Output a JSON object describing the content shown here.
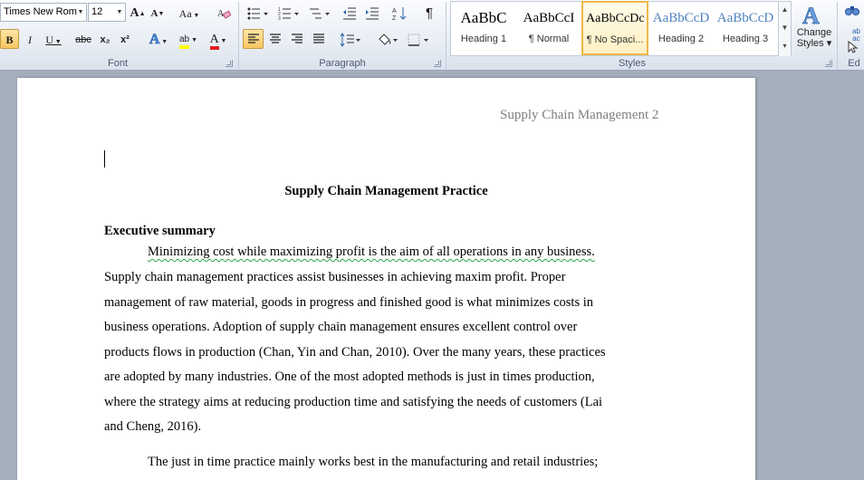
{
  "font_group": {
    "font_name": "Times New Rom",
    "font_size": "12",
    "label": "Font",
    "grow_label": "A",
    "shrink_label": "A",
    "case_label": "Aa",
    "bold_label": "B",
    "italic_label": "I",
    "underline_label": "U",
    "strike_label": "abc",
    "subscript_label": "x₂",
    "superscript_label": "x²",
    "effects_label": "A",
    "highlight_label": "ab",
    "color_label": "A"
  },
  "paragraph_group": {
    "label": "Paragraph",
    "pilcrow": "¶"
  },
  "styles_group": {
    "label": "Styles",
    "tiles": [
      {
        "sample": "AaBbC",
        "name": "Heading 1",
        "color": "#000000"
      },
      {
        "sample": "AaBbCcI",
        "name": "¶ Normal",
        "color": "#000000"
      },
      {
        "sample": "AaBbCcDc",
        "name": "¶ No Spaci...",
        "color": "#000000"
      },
      {
        "sample": "AaBbCcD",
        "name": "Heading 2",
        "color": "#4f81bd"
      },
      {
        "sample": "AaBbCcD",
        "name": "Heading 3",
        "color": "#4f81bd"
      }
    ],
    "change_styles_line1": "Change",
    "change_styles_line2": "Styles ▾"
  },
  "editing_group": {
    "label": "Ed",
    "replace_label": "ab\nac"
  },
  "document": {
    "header": "Supply Chain Management 2",
    "title": "Supply Chain Management Practice",
    "heading": "Executive summary",
    "para1_first": "Minimizing  cost while maximizing  profit is the aim of all operations in any business.",
    "para1_lines": [
      "Supply chain management practices assist businesses in achieving maxim profit. Proper",
      "management of raw material,  goods in progress and finished good is what minimizes  costs in",
      "business operations. Adoption of supply chain management ensures excellent control over",
      "products flows in production (Chan, Yin and Chan, 2010). Over the many years, these practices",
      "are adopted by many industries. One of the most adopted methods is just in times production,",
      "where the strategy aims  at reducing production time and satisfying the needs of customers (Lai",
      "and Cheng, 2016)."
    ],
    "para2_first": "The just in time practice mainly works best in the manufacturing and retail industries;"
  },
  "colors": {
    "ribbon_bg": "#e6ebf3",
    "active_button": "#f9c662",
    "canvas": "#a4aebd",
    "header_text": "#7f7f7f",
    "spell_underline": "#2aa14b",
    "font_color_bar": "#e02020",
    "highlight_bar": "#ffff00"
  }
}
